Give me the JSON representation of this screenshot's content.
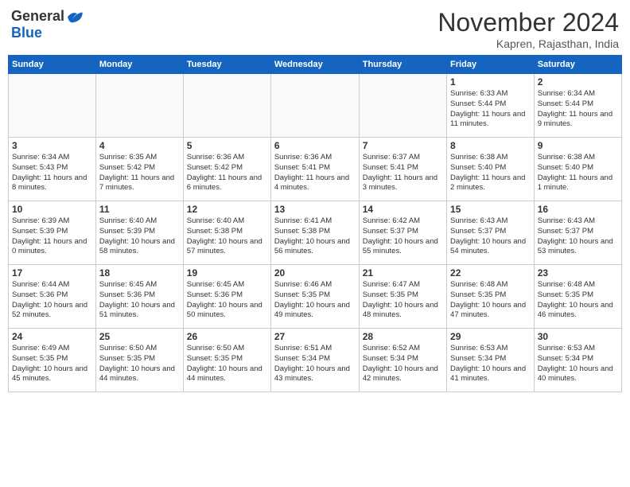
{
  "header": {
    "logo_general": "General",
    "logo_blue": "Blue",
    "month_title": "November 2024",
    "location": "Kapren, Rajasthan, India"
  },
  "days_of_week": [
    "Sunday",
    "Monday",
    "Tuesday",
    "Wednesday",
    "Thursday",
    "Friday",
    "Saturday"
  ],
  "weeks": [
    [
      {
        "day": "",
        "content": ""
      },
      {
        "day": "",
        "content": ""
      },
      {
        "day": "",
        "content": ""
      },
      {
        "day": "",
        "content": ""
      },
      {
        "day": "",
        "content": ""
      },
      {
        "day": "1",
        "content": "Sunrise: 6:33 AM\nSunset: 5:44 PM\nDaylight: 11 hours and 11 minutes."
      },
      {
        "day": "2",
        "content": "Sunrise: 6:34 AM\nSunset: 5:44 PM\nDaylight: 11 hours and 9 minutes."
      }
    ],
    [
      {
        "day": "3",
        "content": "Sunrise: 6:34 AM\nSunset: 5:43 PM\nDaylight: 11 hours and 8 minutes."
      },
      {
        "day": "4",
        "content": "Sunrise: 6:35 AM\nSunset: 5:42 PM\nDaylight: 11 hours and 7 minutes."
      },
      {
        "day": "5",
        "content": "Sunrise: 6:36 AM\nSunset: 5:42 PM\nDaylight: 11 hours and 6 minutes."
      },
      {
        "day": "6",
        "content": "Sunrise: 6:36 AM\nSunset: 5:41 PM\nDaylight: 11 hours and 4 minutes."
      },
      {
        "day": "7",
        "content": "Sunrise: 6:37 AM\nSunset: 5:41 PM\nDaylight: 11 hours and 3 minutes."
      },
      {
        "day": "8",
        "content": "Sunrise: 6:38 AM\nSunset: 5:40 PM\nDaylight: 11 hours and 2 minutes."
      },
      {
        "day": "9",
        "content": "Sunrise: 6:38 AM\nSunset: 5:40 PM\nDaylight: 11 hours and 1 minute."
      }
    ],
    [
      {
        "day": "10",
        "content": "Sunrise: 6:39 AM\nSunset: 5:39 PM\nDaylight: 11 hours and 0 minutes."
      },
      {
        "day": "11",
        "content": "Sunrise: 6:40 AM\nSunset: 5:39 PM\nDaylight: 10 hours and 58 minutes."
      },
      {
        "day": "12",
        "content": "Sunrise: 6:40 AM\nSunset: 5:38 PM\nDaylight: 10 hours and 57 minutes."
      },
      {
        "day": "13",
        "content": "Sunrise: 6:41 AM\nSunset: 5:38 PM\nDaylight: 10 hours and 56 minutes."
      },
      {
        "day": "14",
        "content": "Sunrise: 6:42 AM\nSunset: 5:37 PM\nDaylight: 10 hours and 55 minutes."
      },
      {
        "day": "15",
        "content": "Sunrise: 6:43 AM\nSunset: 5:37 PM\nDaylight: 10 hours and 54 minutes."
      },
      {
        "day": "16",
        "content": "Sunrise: 6:43 AM\nSunset: 5:37 PM\nDaylight: 10 hours and 53 minutes."
      }
    ],
    [
      {
        "day": "17",
        "content": "Sunrise: 6:44 AM\nSunset: 5:36 PM\nDaylight: 10 hours and 52 minutes."
      },
      {
        "day": "18",
        "content": "Sunrise: 6:45 AM\nSunset: 5:36 PM\nDaylight: 10 hours and 51 minutes."
      },
      {
        "day": "19",
        "content": "Sunrise: 6:45 AM\nSunset: 5:36 PM\nDaylight: 10 hours and 50 minutes."
      },
      {
        "day": "20",
        "content": "Sunrise: 6:46 AM\nSunset: 5:35 PM\nDaylight: 10 hours and 49 minutes."
      },
      {
        "day": "21",
        "content": "Sunrise: 6:47 AM\nSunset: 5:35 PM\nDaylight: 10 hours and 48 minutes."
      },
      {
        "day": "22",
        "content": "Sunrise: 6:48 AM\nSunset: 5:35 PM\nDaylight: 10 hours and 47 minutes."
      },
      {
        "day": "23",
        "content": "Sunrise: 6:48 AM\nSunset: 5:35 PM\nDaylight: 10 hours and 46 minutes."
      }
    ],
    [
      {
        "day": "24",
        "content": "Sunrise: 6:49 AM\nSunset: 5:35 PM\nDaylight: 10 hours and 45 minutes."
      },
      {
        "day": "25",
        "content": "Sunrise: 6:50 AM\nSunset: 5:35 PM\nDaylight: 10 hours and 44 minutes."
      },
      {
        "day": "26",
        "content": "Sunrise: 6:50 AM\nSunset: 5:35 PM\nDaylight: 10 hours and 44 minutes."
      },
      {
        "day": "27",
        "content": "Sunrise: 6:51 AM\nSunset: 5:34 PM\nDaylight: 10 hours and 43 minutes."
      },
      {
        "day": "28",
        "content": "Sunrise: 6:52 AM\nSunset: 5:34 PM\nDaylight: 10 hours and 42 minutes."
      },
      {
        "day": "29",
        "content": "Sunrise: 6:53 AM\nSunset: 5:34 PM\nDaylight: 10 hours and 41 minutes."
      },
      {
        "day": "30",
        "content": "Sunrise: 6:53 AM\nSunset: 5:34 PM\nDaylight: 10 hours and 40 minutes."
      }
    ]
  ]
}
